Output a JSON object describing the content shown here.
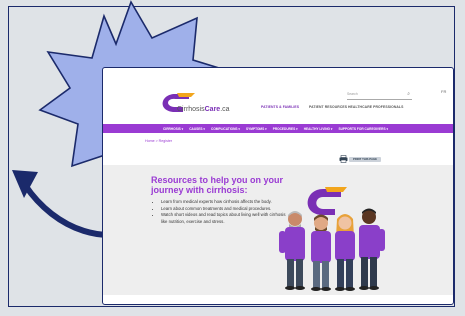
{
  "site": {
    "logo_part1": "Cirrhosis",
    "logo_part2": "Care",
    "logo_tld": ".ca",
    "top_links": [
      "PATIENTS & FAMILIES",
      "PATIENT RESOURCES",
      "HEALTHCARE PROFESSIONALS"
    ],
    "search_placeholder": "Search",
    "lang_label": "FR",
    "menu": [
      "CIRRHOSIS",
      "CAUSES",
      "COMPLICATIONS",
      "SYMPTOMS",
      "PROCEDURES",
      "HEALTHY LIVING",
      "SUPPORTS FOR CAREGIVERS"
    ],
    "breadcrumb": "Home > Register",
    "print_label": "PRINT THIS PAGE",
    "hero_title": "Resources to help you on your journey with cirrhosis:",
    "bullets": [
      "Learn from medical experts how cirrhosis affects the body.",
      "Learn about common treatments and medical procedures.",
      "Watch short videos and read topics about living well with cirrhosis like nutrition, exercise and stress."
    ]
  },
  "colors": {
    "brand_purple": "#9a3bd3",
    "star_fill": "#9fb0ea",
    "arrow_navy": "#1b2a6b",
    "logo_orange": "#f2a51c"
  }
}
